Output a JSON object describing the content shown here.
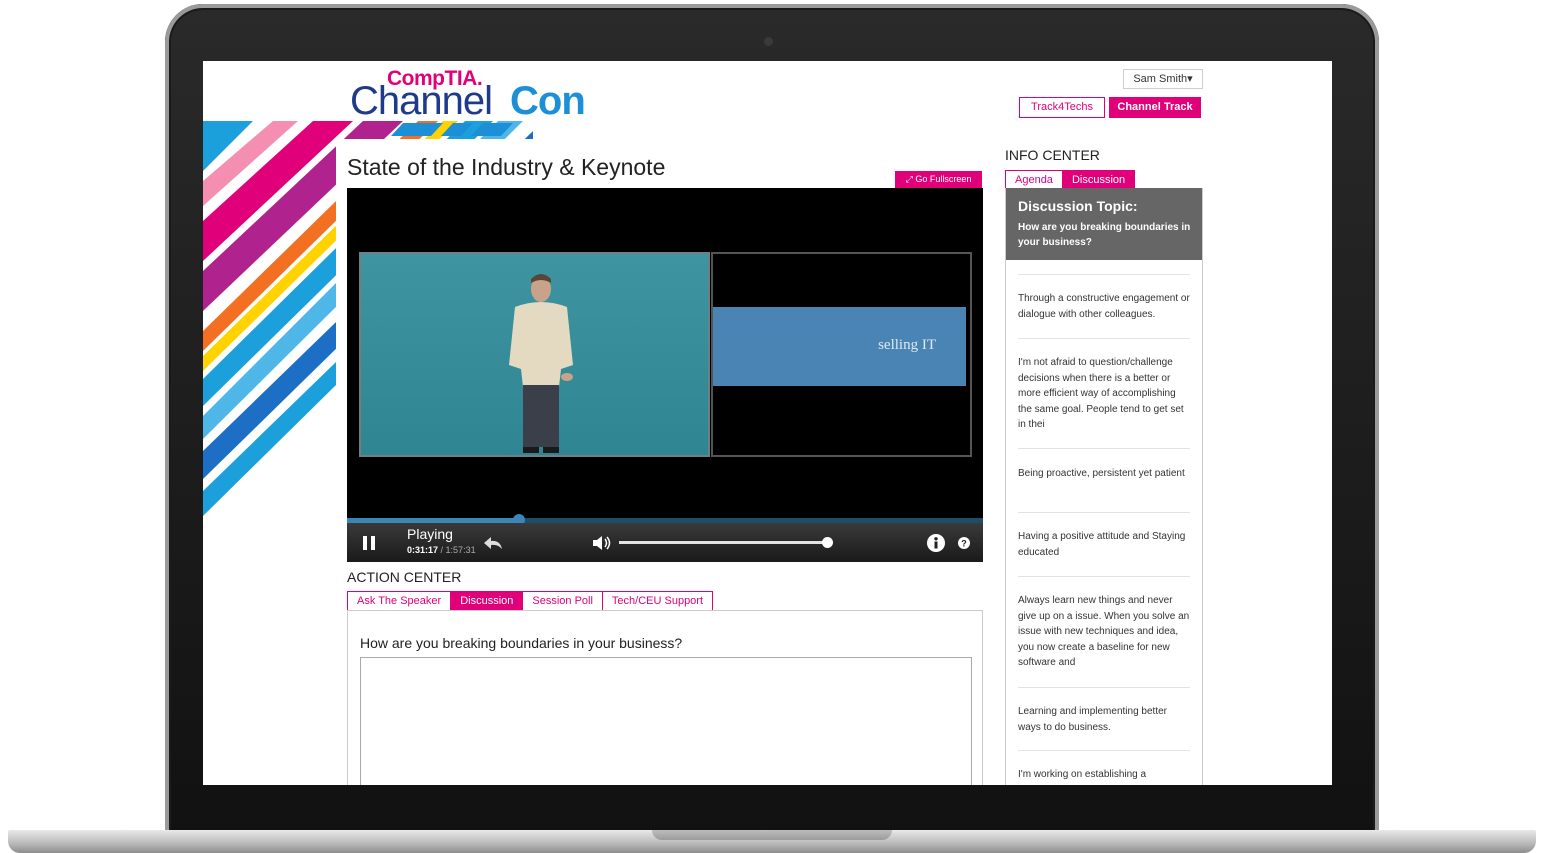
{
  "header": {
    "logo_top": "CompTIA.",
    "logo_main": "Channel",
    "logo_accent": "Con",
    "user": "Sam Smith",
    "tracks": [
      "Track4Techs",
      "Channel Track"
    ]
  },
  "session": {
    "title": "State of the Industry & Keynote",
    "fullscreen_label": "Go Fullscreen"
  },
  "player": {
    "status": "Playing",
    "time_current": "0:31:17",
    "time_separator": " / ",
    "time_total": "1:57:31",
    "progress_fraction": 0.27,
    "volume_fraction": 1.0,
    "slide_text": "selling IT"
  },
  "action_center": {
    "title": "ACTION CENTER",
    "tabs": [
      "Ask The Speaker",
      "Discussion",
      "Session Poll",
      "Tech/CEU Support"
    ],
    "active_tab": "Discussion",
    "question": "How are you breaking boundaries in your business?",
    "answer_value": ""
  },
  "info_center": {
    "title": "INFO CENTER",
    "tabs": [
      "Agenda",
      "Discussion"
    ],
    "active_tab": "Discussion",
    "topic_heading": "Discussion Topic:",
    "topic_question": "How are you breaking boundaries in your business?",
    "comments": [
      "Through a constructive engagement or dialogue with other colleagues.",
      "I'm not afraid to question/challenge decisions when there is a better or more efficient way of accomplishing the same goal. People tend to get set in thei",
      "Being proactive, persistent yet patient",
      "Having a positive attitude and Staying educated",
      "Always learn new things and never give up on a issue. When you solve an issue with new techniques and idea, you now create a baseline for new software and",
      "Learning and implementing better ways to do business.",
      "I'm working on establishing a"
    ]
  },
  "colors": {
    "accent": "#e0007a",
    "logo_blue": "#1f3a8a",
    "logo_light_blue": "#1c8fd6",
    "progress": "#3a86b7"
  },
  "icons": [
    "pause-icon",
    "rewind-icon",
    "volume-icon",
    "info-icon",
    "help-icon",
    "chevron-down-icon",
    "expand-icon"
  ]
}
